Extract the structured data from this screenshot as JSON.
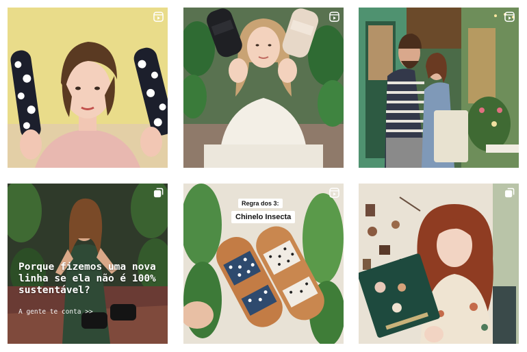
{
  "grid": {
    "tiles": [
      {
        "id": "post-1",
        "kind": "reel",
        "badge_icon": "reel-icon"
      },
      {
        "id": "post-2",
        "kind": "reel",
        "badge_icon": "reel-icon"
      },
      {
        "id": "post-3",
        "kind": "reel",
        "badge_icon": "reel-icon"
      },
      {
        "id": "post-4",
        "kind": "carousel",
        "badge_icon": "carousel-icon",
        "caption": "Porque fizemos uma nova linha se ela não é 100% sustentável?",
        "cta": "A gente te conta >>"
      },
      {
        "id": "post-5",
        "kind": "reel",
        "badge_icon": "reel-icon",
        "label_top": "Regra dos 3:",
        "label_main": "Chinelo Insecta"
      },
      {
        "id": "post-6",
        "kind": "carousel",
        "badge_icon": "carousel-icon"
      }
    ]
  },
  "colors": {
    "tile1_bg": "#e9dc8a",
    "tile2_bg": "#d9d3c5",
    "tile3_bg": "#5a8a5e",
    "tile4_bg": "#2f3a2a",
    "tile5_bg": "#e8e2d6",
    "tile6_bg": "#e9e2d5"
  }
}
